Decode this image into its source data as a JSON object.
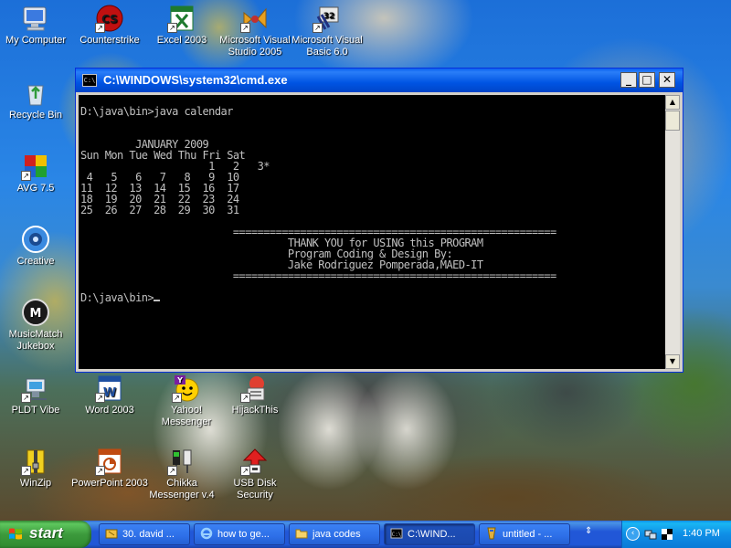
{
  "desktop_icons": [
    {
      "label": "My Computer"
    },
    {
      "label": "Counterstrike"
    },
    {
      "label": "Excel 2003"
    },
    {
      "label": "Microsoft Visual Studio 2005"
    },
    {
      "label": "Microsoft Visual Basic 6.0"
    },
    {
      "label": "Recycle Bin"
    },
    {
      "label": "AVG 7.5"
    },
    {
      "label": "Creative"
    },
    {
      "label": "MusicMatch Jukebox"
    },
    {
      "label": "PLDT Vibe"
    },
    {
      "label": "Word 2003"
    },
    {
      "label": "Yahoo! Messenger"
    },
    {
      "label": "HijackThis"
    },
    {
      "label": "WinZip"
    },
    {
      "label": "PowerPoint 2003"
    },
    {
      "label": "Chikka Messenger v.4"
    },
    {
      "label": "USB Disk Security"
    }
  ],
  "cmd_window": {
    "title": "C:\\WINDOWS\\system32\\cmd.exe",
    "icon_text": "C:\\",
    "buttons": {
      "minimize": "_",
      "maximize": "□",
      "close": "✕"
    },
    "console_text": "D:\\java\\bin>java calendar\n\n\n         JANUARY 2009\nSun Mon Tue Wed Thu Fri Sat\n                     1   2   3*\n 4   5   6   7   8   9  10\n11  12  13  14  15  16  17\n18  19  20  21  22  23  24\n25  26  27  28  29  30  31\n\n                         =====================================================\n                                  THANK YOU for USING this PROGRAM\n                                  Program Coding & Design By:\n                                  Jake Rodriguez Pomperada,MAED-IT\n                         =====================================================\n\nD:\\java\\bin>"
  },
  "taskbar": {
    "start_label": "start",
    "tasks": [
      {
        "label": "30. david ..."
      },
      {
        "label": "how to ge..."
      },
      {
        "label": "java codes"
      },
      {
        "label": "C:\\WIND..."
      },
      {
        "label": "untitled - ..."
      }
    ],
    "clock": "1:40 PM"
  },
  "colors": {
    "titlebar": "#0054e3",
    "console_bg": "#000000",
    "console_fg": "#c0c0c0",
    "taskbar": "#2157d7",
    "start": "#3c9a3c",
    "tray": "#0f8ee6"
  },
  "icons": {
    "my_computer": "monitor-icon",
    "counterstrike": "counterstrike-icon",
    "excel": "excel-icon",
    "visual_studio": "visual-studio-icon",
    "visual_basic": "visual-basic-icon",
    "recycle_bin": "recycle-bin-icon",
    "avg": "avg-icon",
    "creative": "speaker-icon",
    "musicmatch": "musicmatch-icon",
    "pldt": "network-icon",
    "word": "word-icon",
    "yahoo": "yahoo-messenger-icon",
    "hijackthis": "hijackthis-icon",
    "winzip": "winzip-icon",
    "powerpoint": "powerpoint-icon",
    "chikka": "chikka-icon",
    "usb_disk_security": "usb-shield-icon"
  }
}
